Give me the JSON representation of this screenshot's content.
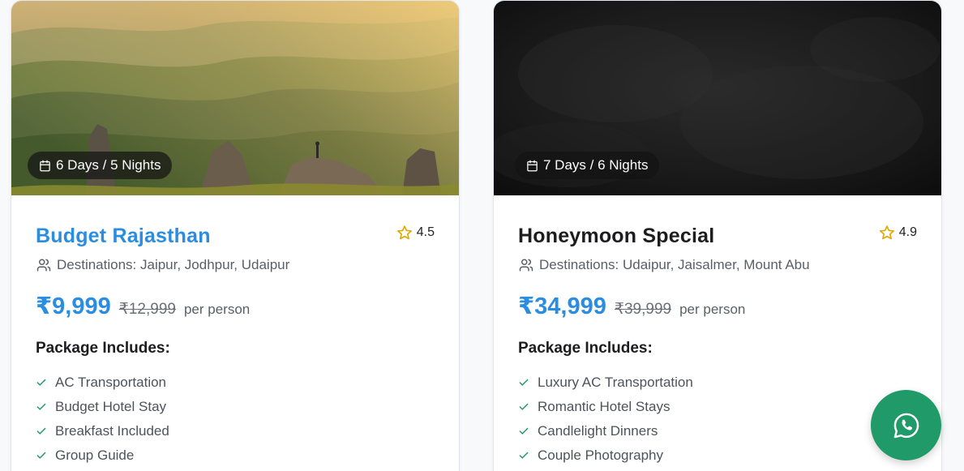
{
  "packages": [
    {
      "duration": "6 Days / 5 Nights",
      "title": "Budget Rajasthan",
      "rating": "4.5",
      "destinations": "Destinations: Jaipur, Jodhpur, Udaipur",
      "price": "₹9,999",
      "old_price": "₹12,999",
      "per_label": "per person",
      "includes_heading": "Package Includes:",
      "features": [
        "AC Transportation",
        "Budget Hotel Stay",
        "Breakfast Included",
        "Group Guide"
      ],
      "title_color": "#2a8de0",
      "image": "mountain-landscape"
    },
    {
      "duration": "7 Days / 6 Nights",
      "title": "Honeymoon Special",
      "rating": "4.9",
      "destinations": "Destinations: Udaipur, Jaisalmer, Mount Abu",
      "price": "₹34,999",
      "old_price": "₹39,999",
      "per_label": "per person",
      "includes_heading": "Package Includes:",
      "features": [
        "Luxury AC Transportation",
        "Romantic Hotel Stays",
        "Candlelight Dinners",
        "Couple Photography"
      ],
      "title_color": "#1d1d1f",
      "image": "dark-texture"
    }
  ],
  "colors": {
    "accent": "#2a8de0",
    "star": "#e0a800",
    "check": "#1f9a68",
    "whatsapp": "#1f9a68"
  },
  "icons": [
    "calendar-icon",
    "star-icon",
    "users-icon",
    "check-icon",
    "whatsapp-icon"
  ]
}
